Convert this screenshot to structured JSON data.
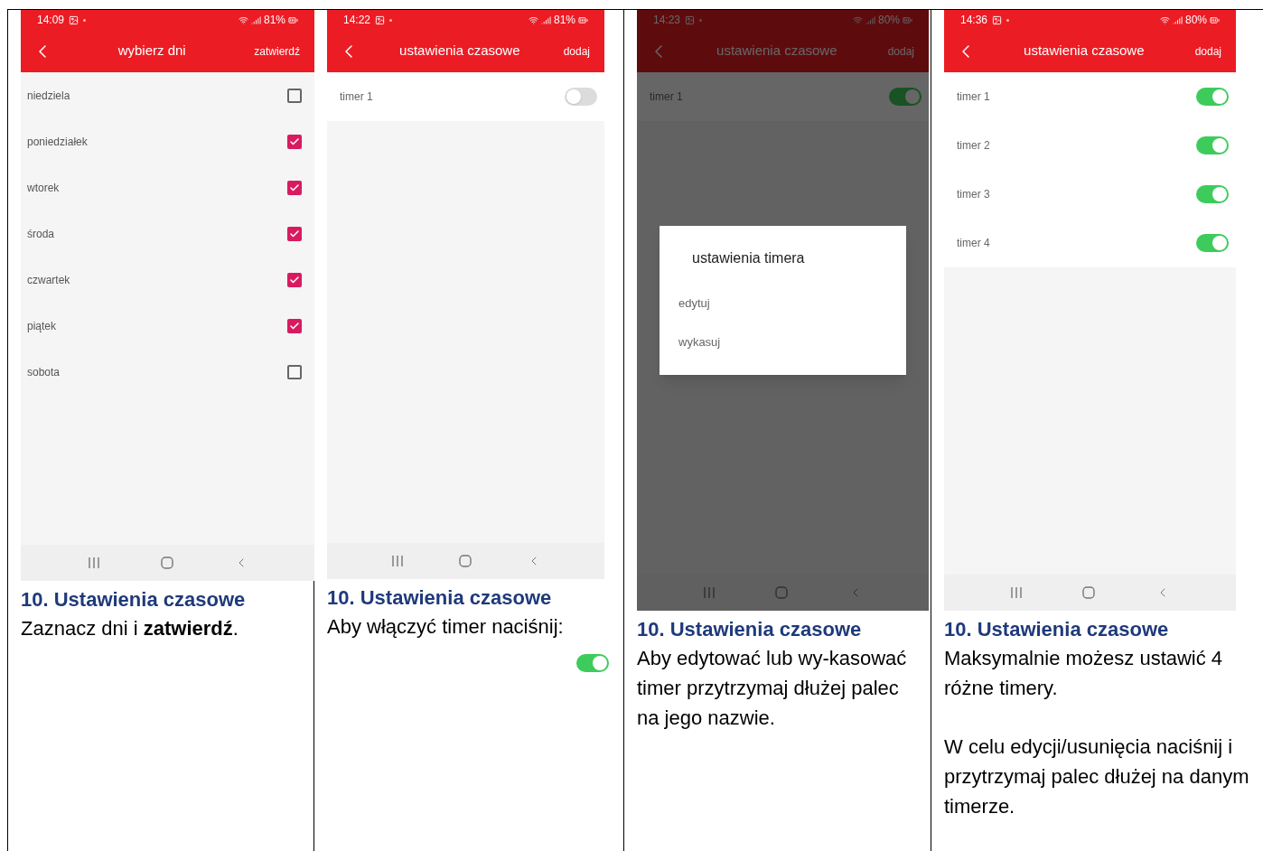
{
  "panels": [
    {
      "phone": {
        "time": "14:09",
        "battery": "81%",
        "title": "wybierz dni",
        "action": "zatwierdź",
        "dimmed": false,
        "content": {
          "kind": "checklist",
          "items": [
            {
              "label": "niedziela",
              "checked": false
            },
            {
              "label": "poniedziałek",
              "checked": true
            },
            {
              "label": "wtorek",
              "checked": true
            },
            {
              "label": "środa",
              "checked": true
            },
            {
              "label": "czwartek",
              "checked": true
            },
            {
              "label": "piątek",
              "checked": true
            },
            {
              "label": "sobota",
              "checked": false
            }
          ]
        }
      },
      "caption": {
        "heading": "10. Ustawienia czasowe",
        "paragraphs": [
          "Zaznacz dni i **zatwierdź**."
        ]
      }
    },
    {
      "phone": {
        "time": "14:22",
        "battery": "81%",
        "title": "ustawienia czasowe",
        "action": "dodaj",
        "dimmed": false,
        "content": {
          "kind": "timers",
          "items": [
            {
              "label": "timer 1",
              "on": false
            }
          ]
        }
      },
      "caption": {
        "heading": "10. Ustawienia czasowe",
        "paragraphs": [
          "Aby włączyć timer naciśnij:"
        ],
        "toggle": {
          "on": true
        }
      }
    },
    {
      "phone": {
        "time": "14:23",
        "battery": "80%",
        "title": "ustawienia czasowe",
        "action": "dodaj",
        "dimmed": true,
        "content": {
          "kind": "timers",
          "items": [
            {
              "label": "timer 1",
              "on": true
            }
          ]
        },
        "dialog": {
          "title": "ustawienia timera",
          "options": [
            "edytuj",
            "wykasuj"
          ]
        }
      },
      "caption": {
        "heading": "10. Ustawienia czasowe",
        "paragraphs": [
          "Aby edytować lub wy-kasować timer przytrzymaj dłużej palec na jego nazwie."
        ]
      }
    },
    {
      "phone": {
        "time": "14:36",
        "battery": "80%",
        "title": "ustawienia czasowe",
        "action": "dodaj",
        "dimmed": false,
        "content": {
          "kind": "timers",
          "items": [
            {
              "label": "timer 1",
              "on": true
            },
            {
              "label": "timer 2",
              "on": true
            },
            {
              "label": "timer 3",
              "on": true
            },
            {
              "label": "timer 4",
              "on": true
            }
          ]
        }
      },
      "caption": {
        "heading": "10. Ustawienia czasowe",
        "paragraphs": [
          "Maksymalnie możesz ustawić 4 różne timery.",
          "W celu edycji/usunięcia naciśnij i przytrzymaj palec dłużej na danym timerze."
        ]
      }
    }
  ]
}
